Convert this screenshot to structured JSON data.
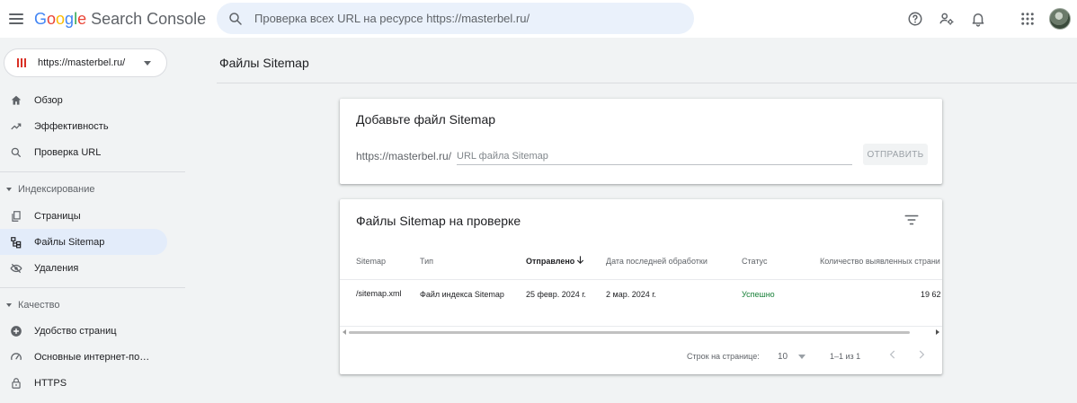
{
  "app": {
    "logo_letters": [
      "G",
      "o",
      "o",
      "g",
      "l",
      "e"
    ],
    "product": "Search Console"
  },
  "search": {
    "placeholder": "Проверка всех URL на ресурсе https://masterbel.ru/"
  },
  "header_icons": [
    "help-icon",
    "manage-users-icon",
    "notifications-icon",
    "apps-icon",
    "account-avatar"
  ],
  "property": {
    "label": "https://masterbel.ru/"
  },
  "sidebar": {
    "items": [
      {
        "label": "Обзор",
        "icon": "home-icon"
      },
      {
        "label": "Эффективность",
        "icon": "trending-icon"
      },
      {
        "label": "Проверка URL",
        "icon": "search-icon"
      }
    ],
    "sections": [
      {
        "label": "Индексирование",
        "items": [
          {
            "label": "Страницы",
            "icon": "pages-icon"
          },
          {
            "label": "Файлы Sitemap",
            "icon": "sitemap-icon",
            "active": true
          },
          {
            "label": "Удаления",
            "icon": "removals-icon"
          }
        ]
      },
      {
        "label": "Качество",
        "items": [
          {
            "label": "Удобство страниц",
            "icon": "page-experience-icon"
          },
          {
            "label": "Основные интернет-по…",
            "icon": "speedometer-icon"
          },
          {
            "label": "HTTPS",
            "icon": "lock-icon"
          }
        ]
      }
    ]
  },
  "page": {
    "title": "Файлы Sitemap"
  },
  "add_card": {
    "title": "Добавьте файл Sitemap",
    "prefix": "https://masterbel.ru/",
    "input_placeholder": "URL файла Sitemap",
    "submit_label": "ОТПРАВИТЬ"
  },
  "list_card": {
    "title": "Файлы Sitemap на проверке",
    "columns": [
      "Sitemap",
      "Тип",
      "Отправлено",
      "Дата последней обработки",
      "Статус",
      "Количество выявленных страни"
    ],
    "sorted_column": "Отправлено",
    "rows": [
      {
        "sitemap": "/sitemap.xml",
        "type": "Файл индекса Sitemap",
        "submitted": "25 февр. 2024 г.",
        "last_read": "2 мар. 2024 г.",
        "status": "Успешно",
        "discovered": "19 62"
      }
    ],
    "pagination": {
      "rows_label": "Строк на странице:",
      "rows_per_page": "10",
      "range": "1–1 из 1"
    }
  },
  "colors": {
    "accent": "#1a73e8",
    "active_nav": "#e3ecfa",
    "success": "#188038",
    "background": "#f1f3f4"
  }
}
